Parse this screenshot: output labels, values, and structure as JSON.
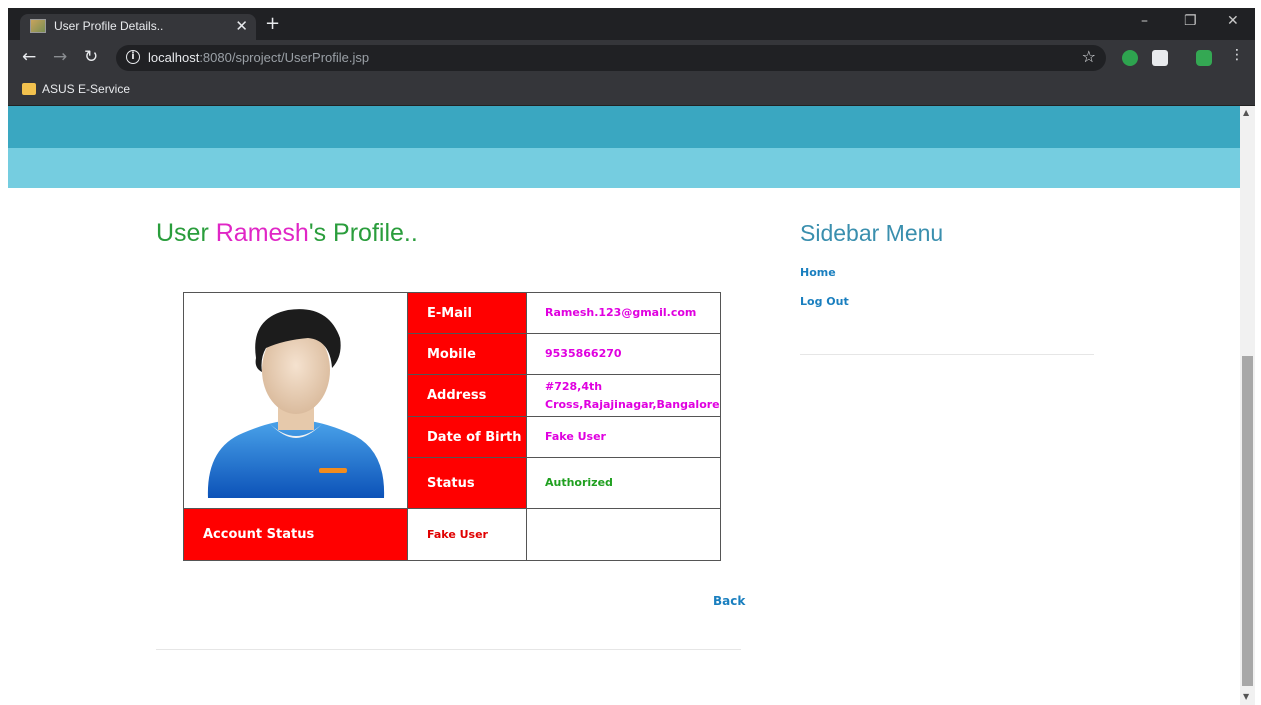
{
  "browser": {
    "tab_title": "User Profile Details..",
    "url_host": "localhost",
    "url_rest": ":8080/sproject/UserProfile.jsp",
    "bookmark": "ASUS E-Service"
  },
  "profile": {
    "title_prefix": "User ",
    "title_name": "Ramesh",
    "title_suffix": "'s Profile..",
    "fields": [
      {
        "label": "E-Mail",
        "value": "Ramesh.123@gmail.com"
      },
      {
        "label": "Mobile",
        "value": "9535866270"
      },
      {
        "label": "Address",
        "value": "#728,4th Cross,Rajajinagar,Bangalore"
      },
      {
        "label": "Date of Birth",
        "value": "Fake User"
      },
      {
        "label": "Status",
        "value": "Authorized"
      }
    ],
    "account_status_label": "Account Status",
    "account_status_value": "Fake User",
    "back_label": "Back"
  },
  "sidebar": {
    "title": "Sidebar Menu",
    "links": [
      "Home",
      "Log Out"
    ]
  },
  "colors": {
    "banner_dark": "#3aa7c1",
    "banner_light": "#75cde0",
    "label_red": "#ff0000",
    "name_magenta": "#e026c6",
    "title_green": "#2a9d3c",
    "link_blue": "#1a7fbf"
  }
}
